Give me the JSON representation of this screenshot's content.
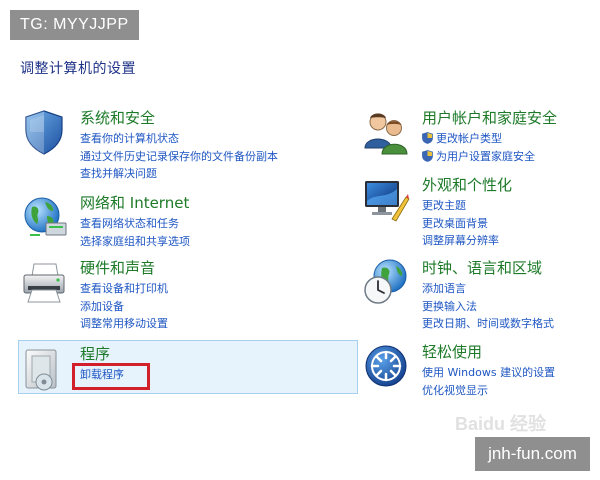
{
  "watermark_top": "TG: MYYJJPP",
  "watermark_bottom": "jnh-fun.com",
  "watermark_baidu": "Baidu 经验",
  "page_title": "调整计算机的设置",
  "left_column": [
    {
      "icon": "security-shield-icon",
      "title": "系统和安全",
      "links": [
        "查看你的计算机状态",
        "通过文件历史记录保存你的文件备份副本",
        "查找并解决问题"
      ]
    },
    {
      "icon": "network-globe-icon",
      "title": "网络和 Internet",
      "links": [
        "查看网络状态和任务",
        "选择家庭组和共享选项"
      ]
    },
    {
      "icon": "printer-icon",
      "title": "硬件和声音",
      "links": [
        "查看设备和打印机",
        "添加设备",
        "调整常用移动设置"
      ]
    },
    {
      "icon": "programs-icon",
      "title": "程序",
      "links": [
        "卸载程序"
      ],
      "selected": true
    }
  ],
  "right_column": [
    {
      "icon": "users-icon",
      "title": "用户帐户和家庭安全",
      "links": [
        "更改帐户类型",
        "为用户设置家庭安全"
      ],
      "link_icons": [
        "uac-shield-icon",
        "uac-shield-icon"
      ]
    },
    {
      "icon": "display-personalization-icon",
      "title": "外观和个性化",
      "links": [
        "更改主题",
        "更改桌面背景",
        "调整屏幕分辨率"
      ]
    },
    {
      "icon": "clock-globe-icon",
      "title": "时钟、语言和区域",
      "links": [
        "添加语言",
        "更换输入法",
        "更改日期、时间或数字格式"
      ]
    },
    {
      "icon": "ease-of-access-icon",
      "title": "轻松使用",
      "links": [
        "使用 Windows 建议的设置",
        "优化视觉显示"
      ]
    }
  ],
  "colors": {
    "heading_green": "#1d7a28",
    "link_blue": "#1f57c3",
    "title_blue": "#1e3287",
    "selection_bg": "#e6f3fc",
    "highlight_red": "#d2202b"
  }
}
